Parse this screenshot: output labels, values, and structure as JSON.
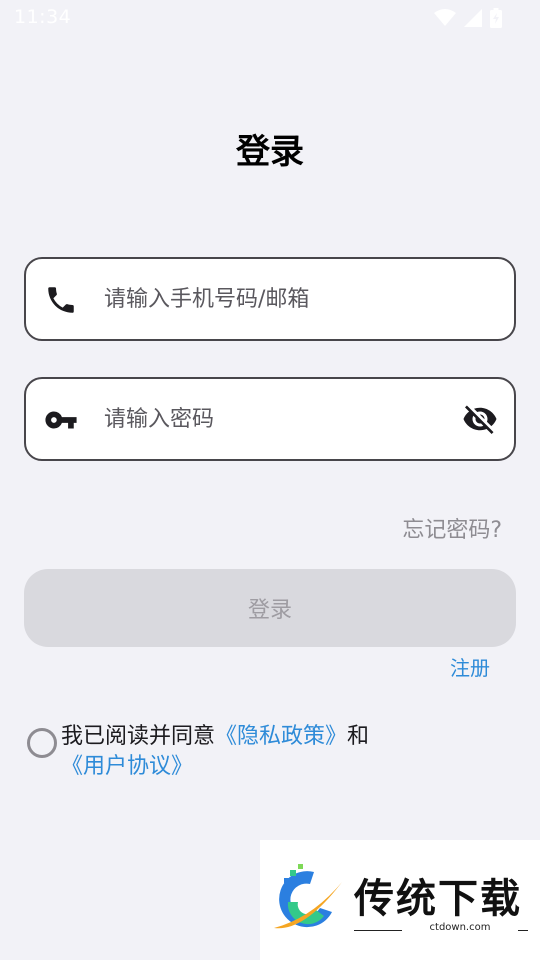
{
  "status_bar": {
    "time": "11:34",
    "icons": [
      "wifi-icon",
      "cellular-icon",
      "battery-charging-icon"
    ]
  },
  "page": {
    "title": "登录"
  },
  "phone_field": {
    "icon": "phone-icon",
    "placeholder": "请输入手机号码/邮箱",
    "value": ""
  },
  "password_field": {
    "icon": "key-icon",
    "placeholder": "请输入密码",
    "value": "",
    "toggle_icon": "eye-off-icon"
  },
  "forgot_password": {
    "label": "忘记密码?"
  },
  "login_button": {
    "label": "登录"
  },
  "register": {
    "label": "注册"
  },
  "agreement": {
    "prefix": "我已阅读并同意",
    "privacy_label": "《隐私政策》",
    "conjunction": "和",
    "terms_label": "《用户协议》",
    "checked": false
  },
  "watermark": {
    "brand": "传统下载",
    "domain": "ctdown.com"
  },
  "colors": {
    "background": "#f2f2f7",
    "link": "#2e8bd8",
    "button_disabled": "#d9d9de"
  }
}
